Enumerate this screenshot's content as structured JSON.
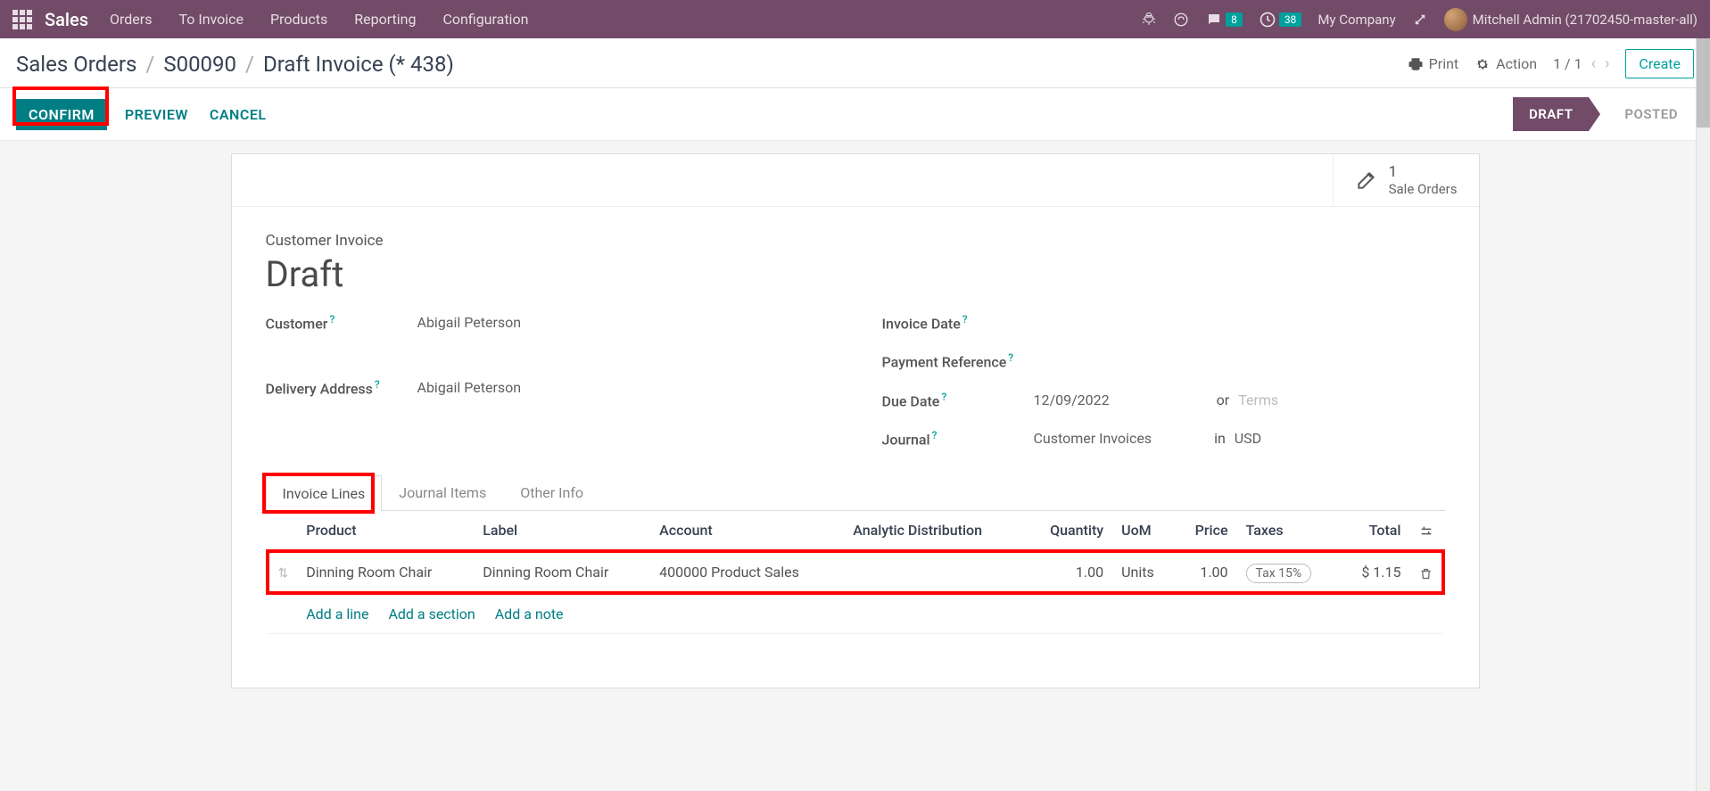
{
  "nav": {
    "brand": "Sales",
    "menu": [
      "Orders",
      "To Invoice",
      "Products",
      "Reporting",
      "Configuration"
    ],
    "messages_badge": "8",
    "activities_badge": "38",
    "company": "My Company",
    "user": "Mitchell Admin (21702450-master-all)"
  },
  "breadcrumb": {
    "items": [
      "Sales Orders",
      "S00090",
      "Draft Invoice (* 438)"
    ]
  },
  "controls": {
    "print": "Print",
    "action": "Action",
    "pager": "1 / 1",
    "create": "Create"
  },
  "statusbar": {
    "confirm": "CONFIRM",
    "preview": "PREVIEW",
    "cancel": "CANCEL",
    "draft": "DRAFT",
    "posted": "POSTED"
  },
  "smart_button": {
    "count": "1",
    "label": "Sale Orders"
  },
  "form": {
    "small_title": "Customer Invoice",
    "big_title": "Draft",
    "customer_label": "Customer",
    "customer_value": "Abigail Peterson",
    "delivery_label": "Delivery Address",
    "delivery_value": "Abigail Peterson",
    "invoice_date_label": "Invoice Date",
    "payment_ref_label": "Payment Reference",
    "due_date_label": "Due Date",
    "due_date_value": "12/09/2022",
    "or_text": "or",
    "terms_text": "Terms",
    "journal_label": "Journal",
    "journal_value": "Customer Invoices",
    "in_text": "in",
    "currency": "USD"
  },
  "tabs": {
    "invoice_lines": "Invoice Lines",
    "journal_items": "Journal Items",
    "other_info": "Other Info"
  },
  "table": {
    "headers": {
      "product": "Product",
      "label": "Label",
      "account": "Account",
      "analytic": "Analytic Distribution",
      "quantity": "Quantity",
      "uom": "UoM",
      "price": "Price",
      "taxes": "Taxes",
      "total": "Total"
    },
    "row": {
      "product": "Dinning Room Chair",
      "label": "Dinning Room Chair",
      "account": "400000 Product Sales",
      "analytic": "",
      "quantity": "1.00",
      "uom": "Units",
      "price": "1.00",
      "taxes": "Tax 15%",
      "total": "$ 1.15"
    },
    "add_line": "Add a line",
    "add_section": "Add a section",
    "add_note": "Add a note"
  }
}
